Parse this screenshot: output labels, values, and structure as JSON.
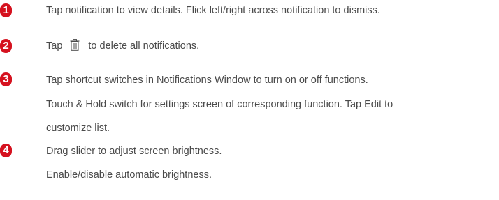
{
  "steps": [
    {
      "number": "1",
      "lines": [
        "Tap notification to view details. Flick left/right across notification to dismiss."
      ]
    },
    {
      "number": "2",
      "text_before_icon": "Tap",
      "icon": "trash-icon",
      "text_after_icon": "to delete all notifications."
    },
    {
      "number": "3",
      "lines": [
        "Tap shortcut switches in Notifications Window to turn on or off functions.",
        "Touch & Hold switch for settings screen of corresponding function. Tap Edit to",
        "customize list."
      ]
    },
    {
      "number": "4",
      "lines": [
        "Drag slider to adjust screen brightness.",
        "Enable/disable automatic brightness."
      ]
    }
  ],
  "colors": {
    "badge": "#d5121f",
    "text": "#4a4a4a"
  }
}
